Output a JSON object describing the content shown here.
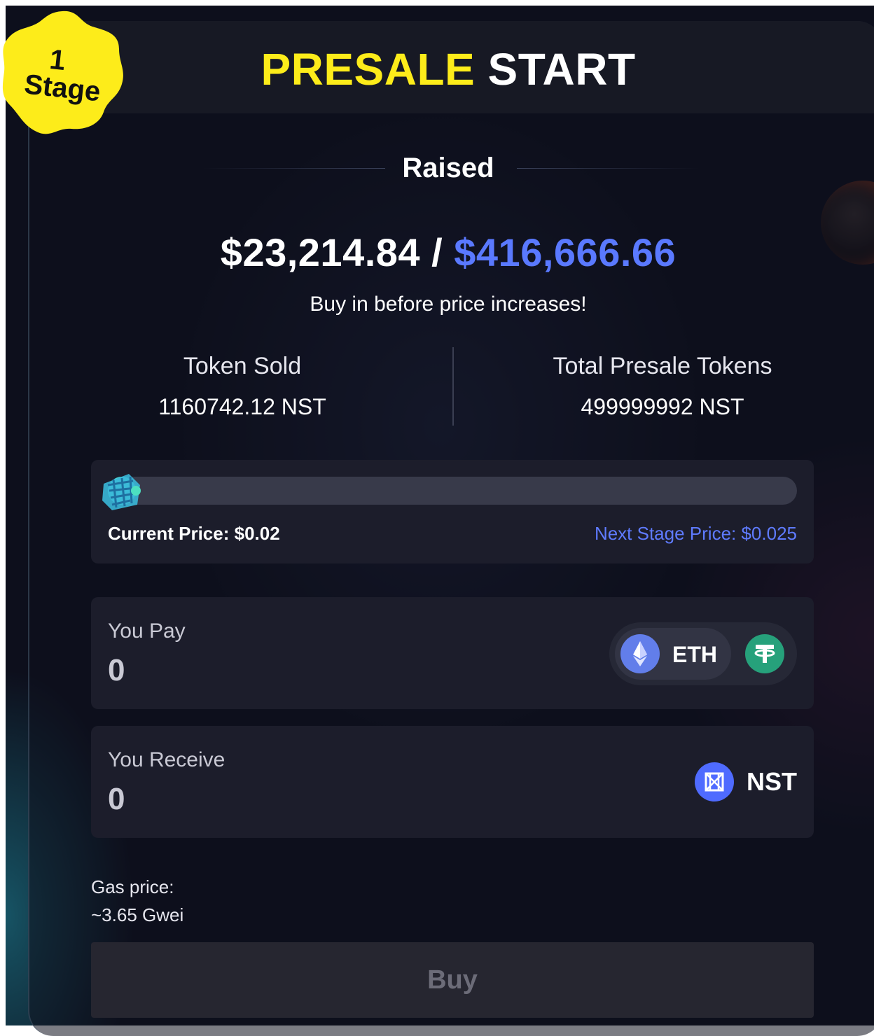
{
  "header": {
    "title_accent": "PRESALE",
    "title_rest": "START",
    "stage_badge": {
      "number": "1",
      "label": "Stage",
      "color": "#fdec1a"
    }
  },
  "raised": {
    "label": "Raised",
    "amount_raised": "$23,214.84",
    "separator": "/",
    "amount_target": "$416,666.66",
    "tagline": "Buy in before price increases!"
  },
  "stats": {
    "token_sold_label": "Token Sold",
    "token_sold_value": "1160742.12 NST",
    "total_tokens_label": "Total Presale Tokens",
    "total_tokens_value": "499999992 NST"
  },
  "progress": {
    "fraction": 0.0023,
    "current_price": "Current Price: $0.02",
    "next_price": "Next Stage Price: $0.025"
  },
  "pay": {
    "label": "You Pay",
    "value": "0",
    "tokens": [
      {
        "label": "ETH",
        "icon": "ethereum-icon",
        "selected": true
      },
      {
        "label": "",
        "icon": "tether-icon",
        "selected": false
      }
    ]
  },
  "receive": {
    "label": "You Receive",
    "value": "0",
    "token_label": "NST",
    "token_icon": "nst-token-icon"
  },
  "gas": {
    "label": "Gas price:",
    "value": "~3.65 Gwei"
  },
  "buy_button": {
    "label": "Buy"
  },
  "colors": {
    "accent_yellow": "#fdec1a",
    "accent_blue": "#5a79ff",
    "background": "#0d0f1c",
    "panel": "#1c1d2b"
  }
}
